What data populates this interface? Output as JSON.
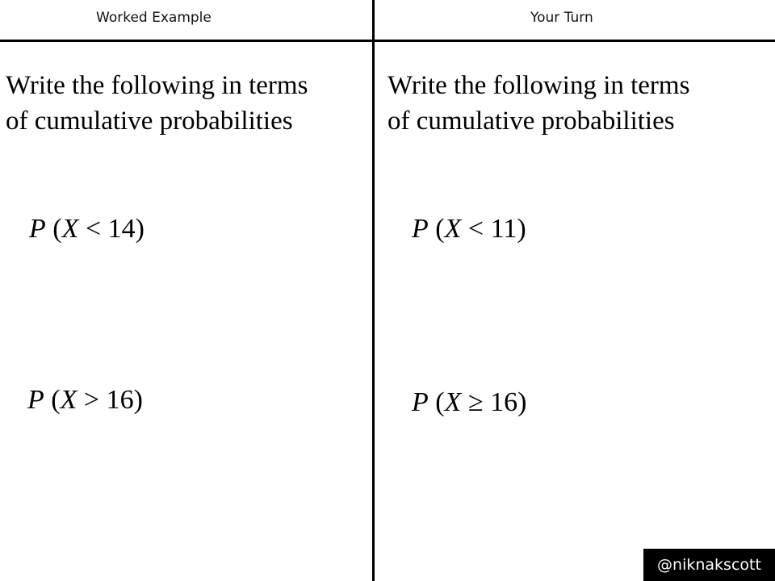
{
  "header": {
    "left_title": "Worked Example",
    "right_title": "Your Turn"
  },
  "worked_example": {
    "instruction_line1": "Write the following in terms",
    "instruction_line2": "of cumulative probabilities",
    "questions": [
      {
        "fn": "P",
        "var": "X",
        "op": "<",
        "value": "14"
      },
      {
        "fn": "P",
        "var": "X",
        "op": ">",
        "value": "16"
      }
    ]
  },
  "your_turn": {
    "instruction_line1": "Write the following in terms",
    "instruction_line2": "of cumulative probabilities",
    "questions": [
      {
        "fn": "P",
        "var": "X",
        "op": "<",
        "value": "11"
      },
      {
        "fn": "P",
        "var": "X",
        "op": "≥",
        "value": "16"
      }
    ]
  },
  "watermark": "@niknakscott"
}
